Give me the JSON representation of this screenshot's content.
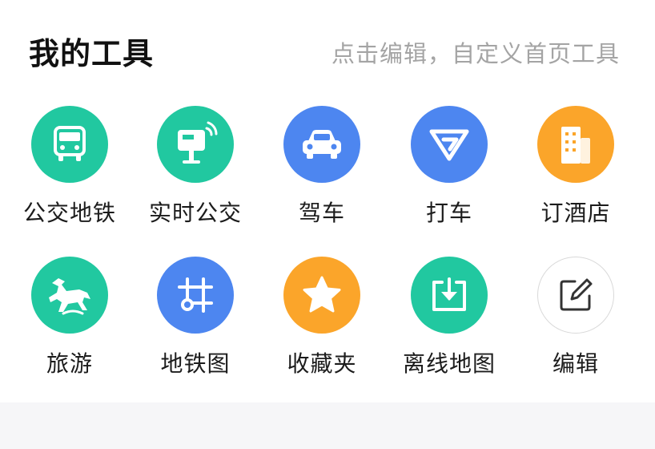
{
  "header": {
    "title": "我的工具",
    "hint": "点击编辑，自定义首页工具"
  },
  "tools": [
    {
      "label": "公交地铁",
      "icon": "bus-icon",
      "color": "#21c8a0"
    },
    {
      "label": "实时公交",
      "icon": "bus-stop-sign-icon",
      "color": "#21c8a0"
    },
    {
      "label": "驾车",
      "icon": "car-icon",
      "color": "#4d86f0"
    },
    {
      "label": "打车",
      "icon": "taxi-logo-icon",
      "color": "#4d86f0"
    },
    {
      "label": "订酒店",
      "icon": "hotel-building-icon",
      "color": "#fba52a"
    },
    {
      "label": "旅游",
      "icon": "galloping-horse-icon",
      "color": "#21c8a0"
    },
    {
      "label": "地铁图",
      "icon": "subway-map-icon",
      "color": "#4d86f0"
    },
    {
      "label": "收藏夹",
      "icon": "star-icon",
      "color": "#fba52a"
    },
    {
      "label": "离线地图",
      "icon": "download-tray-icon",
      "color": "#21c8a0"
    },
    {
      "label": "编辑",
      "icon": "edit-pencil-icon",
      "color": "#ffffff"
    }
  ]
}
